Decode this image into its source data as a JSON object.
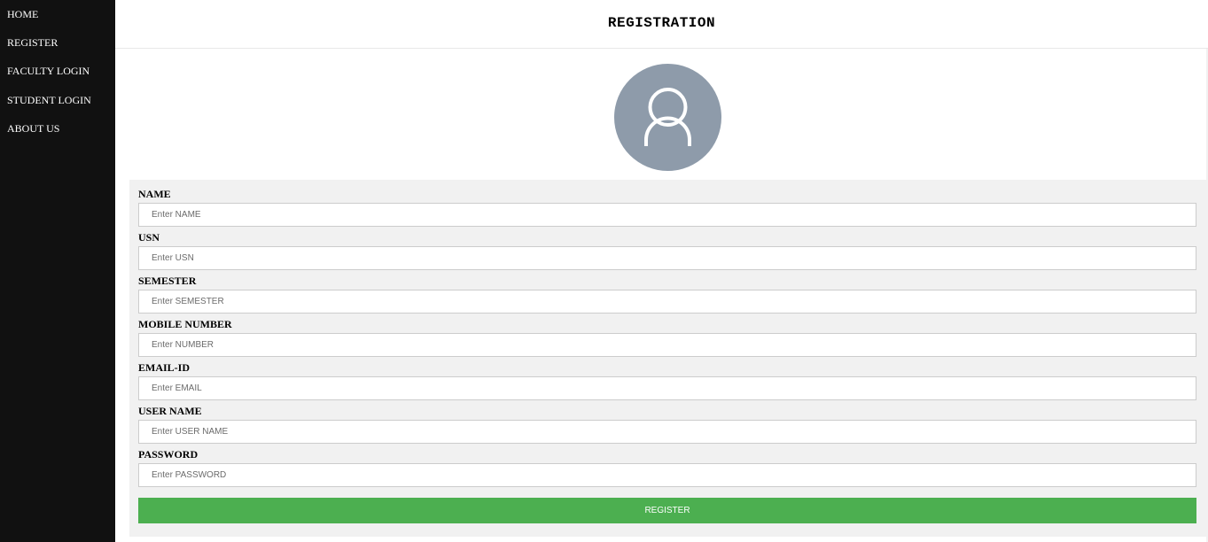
{
  "sidebar": {
    "items": [
      {
        "label": "HOME"
      },
      {
        "label": "REGISTER"
      },
      {
        "label": "FACULTY LOGIN"
      },
      {
        "label": "STUDENT LOGIN"
      },
      {
        "label": "ABOUT US"
      }
    ]
  },
  "header": {
    "title": "REGISTRATION"
  },
  "avatar": {
    "icon": "user-icon",
    "background": "#8e9baa"
  },
  "form": {
    "fields": [
      {
        "label": "NAME",
        "placeholder": "Enter NAME",
        "value": ""
      },
      {
        "label": "USN",
        "placeholder": "Enter USN",
        "value": ""
      },
      {
        "label": "SEMESTER",
        "placeholder": "Enter SEMESTER",
        "value": ""
      },
      {
        "label": "MOBILE NUMBER",
        "placeholder": "Enter NUMBER",
        "value": ""
      },
      {
        "label": "EMAIL-ID",
        "placeholder": "Enter EMAIL",
        "value": ""
      },
      {
        "label": "USER NAME",
        "placeholder": "Enter USER NAME",
        "value": ""
      },
      {
        "label": "PASSWORD",
        "placeholder": "Enter PASSWORD",
        "value": ""
      }
    ],
    "submit_label": "REGISTER"
  },
  "colors": {
    "sidebar_bg": "#111111",
    "form_bg": "#f1f1f1",
    "button_bg": "#4caf50"
  }
}
